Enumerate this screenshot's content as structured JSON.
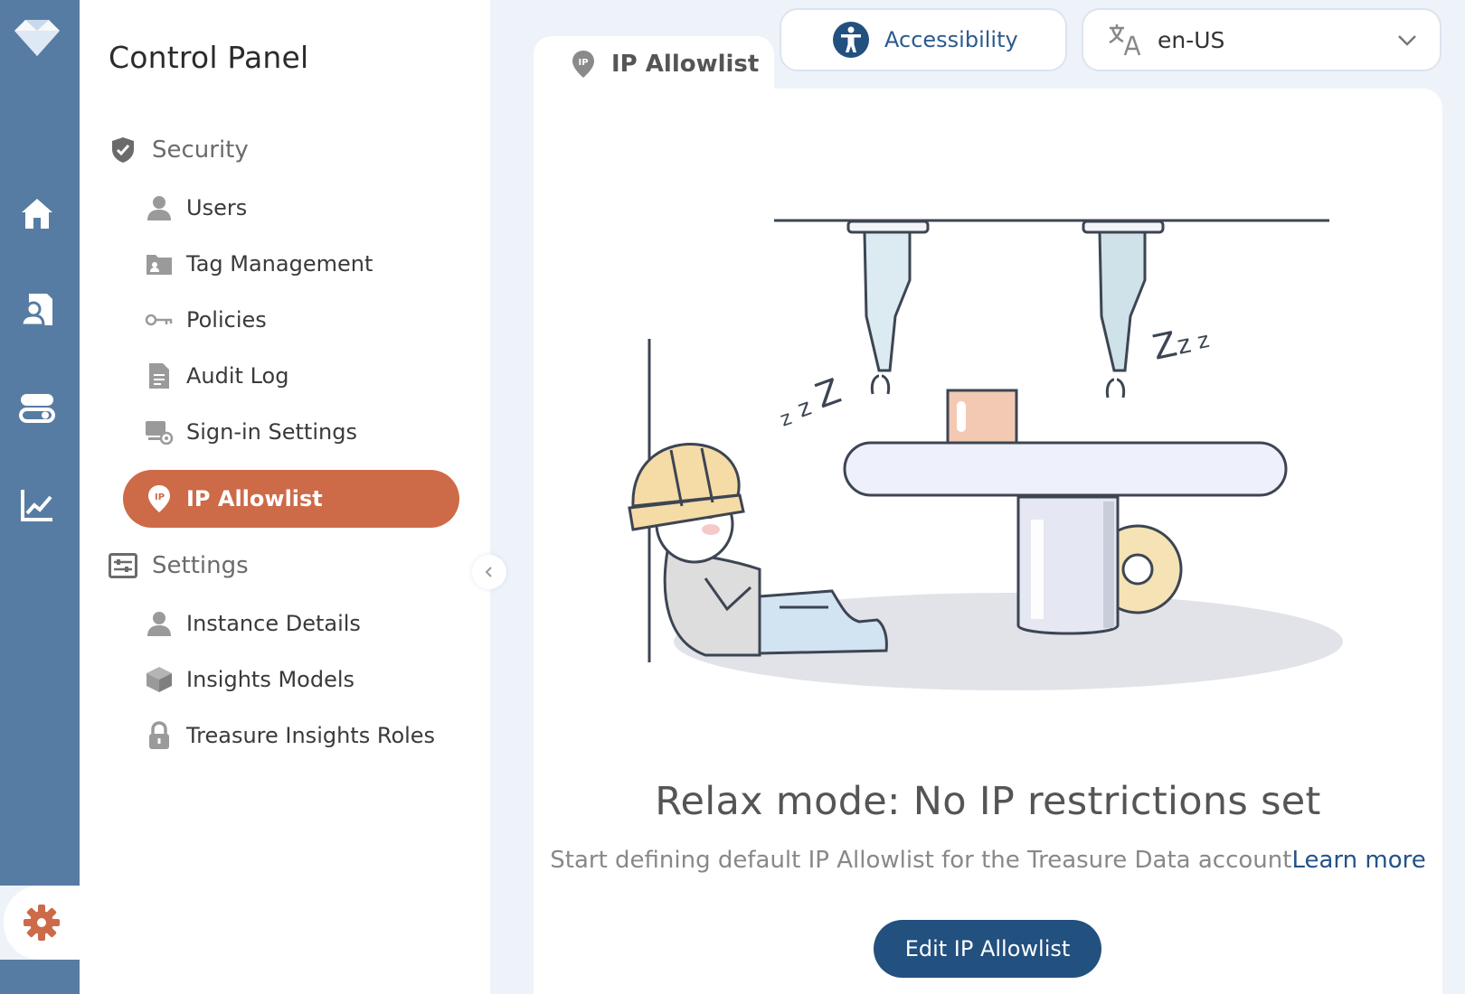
{
  "sidebar": {
    "title": "Control Panel",
    "groups": [
      {
        "label": "Security",
        "items": [
          {
            "label": "Users",
            "icon": "user-icon"
          },
          {
            "label": "Tag Management",
            "icon": "tag-folder-icon"
          },
          {
            "label": "Policies",
            "icon": "key-icon"
          },
          {
            "label": "Audit Log",
            "icon": "document-icon"
          },
          {
            "label": "Sign-in Settings",
            "icon": "monitor-gear-icon"
          },
          {
            "label": "IP Allowlist",
            "icon": "ip-pin-icon",
            "active": true
          }
        ]
      },
      {
        "label": "Settings",
        "items": [
          {
            "label": "Instance Details",
            "icon": "user-icon"
          },
          {
            "label": "Insights Models",
            "icon": "cube-icon"
          },
          {
            "label": "Treasure Insights Roles",
            "icon": "lock-icon"
          }
        ]
      }
    ]
  },
  "rail": {
    "items": [
      "home-icon",
      "user-document-icon",
      "toggle-icon",
      "chart-icon",
      "gear-icon"
    ]
  },
  "header": {
    "accessibility_label": "Accessibility",
    "language_value": "en-US"
  },
  "tab": {
    "label": "IP Allowlist"
  },
  "empty_state": {
    "title": "Relax mode: No IP restrictions set",
    "subtitle": "Start defining default IP Allowlist for the Treasure Data account",
    "learn_more": "Learn more",
    "button_label": "Edit IP Allowlist"
  },
  "colors": {
    "rail": "#577ca3",
    "accent": "#cd6a48",
    "primary_button": "#22507f",
    "link": "#23528a"
  }
}
